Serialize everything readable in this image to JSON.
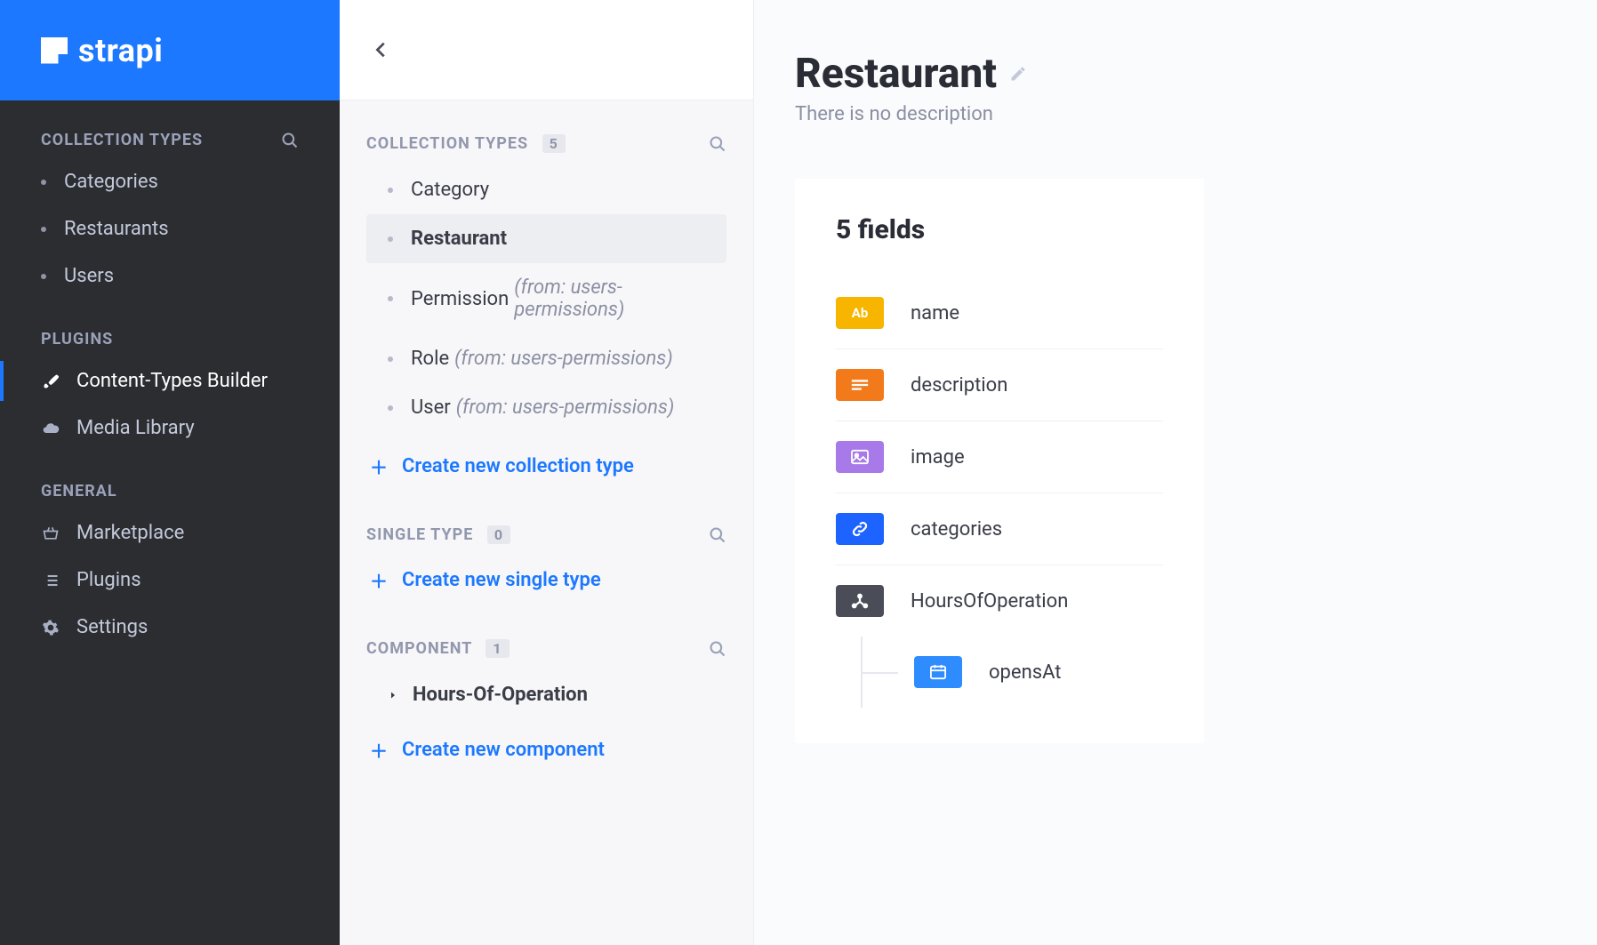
{
  "brand": {
    "name": "strapi"
  },
  "sidebar": {
    "sections": {
      "collectionTypes": {
        "title": "COLLECTION TYPES"
      },
      "plugins": {
        "title": "PLUGINS"
      },
      "general": {
        "title": "GENERAL"
      }
    },
    "collectionTypes": [
      {
        "label": "Categories"
      },
      {
        "label": "Restaurants"
      },
      {
        "label": "Users"
      }
    ],
    "plugins": [
      {
        "label": "Content-Types Builder",
        "active": true
      },
      {
        "label": "Media Library"
      }
    ],
    "general": [
      {
        "label": "Marketplace"
      },
      {
        "label": "Plugins"
      },
      {
        "label": "Settings"
      }
    ]
  },
  "builder": {
    "collection": {
      "title": "COLLECTION TYPES",
      "count": "5"
    },
    "single": {
      "title": "SINGLE TYPE",
      "count": "0"
    },
    "component": {
      "title": "COMPONENT",
      "count": "1"
    },
    "collectionItems": [
      {
        "label": "Category"
      },
      {
        "label": "Restaurant",
        "selected": true
      },
      {
        "label": "Permission",
        "from": "(from: users-permissions)"
      },
      {
        "label": "Role",
        "from": "(from: users-permissions)"
      },
      {
        "label": "User",
        "from": "(from: users-permissions)"
      }
    ],
    "componentItems": [
      {
        "label": "Hours-Of-Operation"
      }
    ],
    "actions": {
      "createCollection": "Create new collection type",
      "createSingle": "Create new single type",
      "createComponent": "Create new component"
    }
  },
  "detail": {
    "title": "Restaurant",
    "description": "There is no description",
    "fieldsCountLabel": "5 fields",
    "fields": [
      {
        "kind": "text",
        "name": "name"
      },
      {
        "kind": "rich",
        "name": "description"
      },
      {
        "kind": "media",
        "name": "image"
      },
      {
        "kind": "relation",
        "name": "categories"
      },
      {
        "kind": "component",
        "name": "HoursOfOperation"
      }
    ],
    "nestedFields": [
      {
        "kind": "date",
        "name": "opensAt"
      }
    ]
  }
}
